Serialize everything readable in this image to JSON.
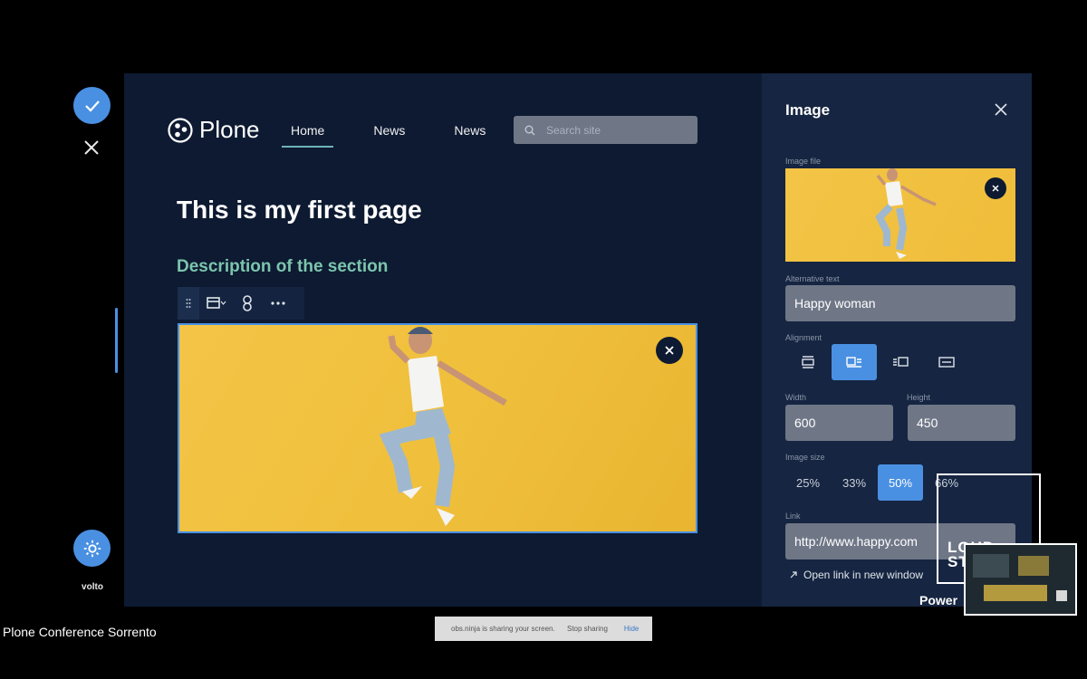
{
  "toolbar": {
    "save_icon": "check-icon",
    "cancel_icon": "close-icon",
    "settings_icon": "gear-icon",
    "brand": "volto"
  },
  "site": {
    "logo_text": "Plone",
    "nav": [
      {
        "label": "Home",
        "active": true
      },
      {
        "label": "News",
        "active": false
      },
      {
        "label": "News",
        "active": false
      }
    ],
    "search_placeholder": "Search site"
  },
  "page": {
    "title": "This is my first page",
    "description": "Description of the section"
  },
  "sidebar": {
    "title": "Image",
    "image_file_label": "Image file",
    "alt_label": "Alternative text",
    "alt_value": "Happy woman",
    "alignment_label": "Alignment",
    "alignment_options": [
      "left",
      "center",
      "right",
      "full"
    ],
    "alignment_selected": "center",
    "width_label": "Width",
    "width_value": "600",
    "height_label": "Height",
    "height_value": "450",
    "size_label": "Image size",
    "sizes": [
      {
        "label": "25%",
        "active": false
      },
      {
        "label": "33%",
        "active": false
      },
      {
        "label": "50%",
        "active": true
      },
      {
        "label": "66%",
        "active": false
      }
    ],
    "link_label": "Link",
    "link_value": "http://www.happy.com",
    "open_new_window": "Open link in new window"
  },
  "meeting": {
    "name": "Plone Conference Sorrento",
    "share_message": "obs.ninja is sharing your screen.",
    "stop_sharing": "Stop sharing",
    "hide": "Hide",
    "sponsor_text": "LOUD\nST",
    "powered": "Power"
  },
  "colors": {
    "accent": "#4a90e2",
    "editor_bg": "#0d1a31",
    "sidebar_bg": "#162541",
    "description_color": "#7cc5ae",
    "image_yellow": "#f3c446"
  }
}
